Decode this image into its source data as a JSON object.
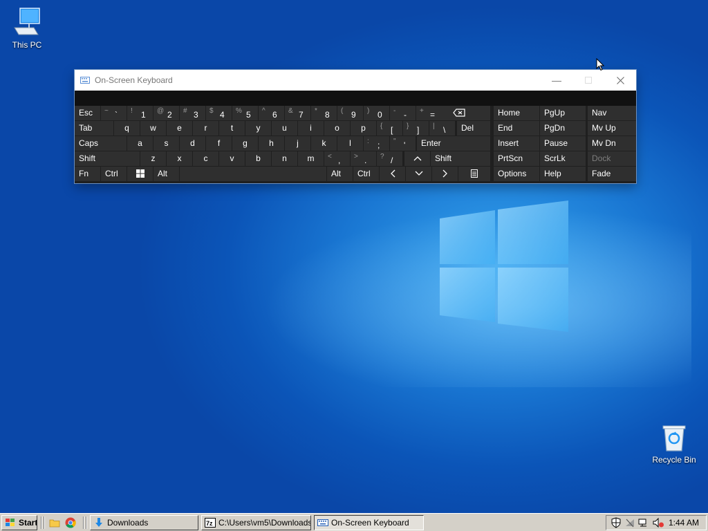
{
  "desktop": {
    "icons": [
      {
        "label": "This PC",
        "icon": "computer-icon"
      },
      {
        "label": "Recycle Bin",
        "icon": "recycle-bin-icon"
      }
    ]
  },
  "osk": {
    "title": "On-Screen Keyboard",
    "keys": {
      "esc": "Esc",
      "tab": "Tab",
      "caps": "Caps",
      "shift_l": "Shift",
      "fn": "Fn",
      "ctrl_l": "Ctrl",
      "alt_l": "Alt",
      "alt_r": "Alt",
      "ctrl_r": "Ctrl",
      "del": "Del",
      "enter": "Enter",
      "shift_r": "Shift",
      "home": "Home",
      "pgup": "PgUp",
      "nav": "Nav",
      "end": "End",
      "pgdn": "PgDn",
      "mvup": "Mv Up",
      "insert": "Insert",
      "pause": "Pause",
      "mvdn": "Mv Dn",
      "prtscn": "PrtScn",
      "scrlk": "ScrLk",
      "dock": "Dock",
      "options": "Options",
      "help": "Help",
      "fade": "Fade"
    },
    "number_row": [
      {
        "sub": "~",
        "main": "`"
      },
      {
        "sub": "!",
        "main": "1"
      },
      {
        "sub": "@",
        "main": "2"
      },
      {
        "sub": "#",
        "main": "3"
      },
      {
        "sub": "$",
        "main": "4"
      },
      {
        "sub": "%",
        "main": "5"
      },
      {
        "sub": "^",
        "main": "6"
      },
      {
        "sub": "&",
        "main": "7"
      },
      {
        "sub": "*",
        "main": "8"
      },
      {
        "sub": "(",
        "main": "9"
      },
      {
        "sub": ")",
        "main": "0"
      },
      {
        "sub": "-",
        "main": "-"
      },
      {
        "sub": "+",
        "main": "="
      }
    ],
    "qwerty_row": [
      "q",
      "w",
      "e",
      "r",
      "t",
      "y",
      "u",
      "i",
      "o",
      "p"
    ],
    "qwerty_punct": [
      {
        "sub": "{",
        "main": "["
      },
      {
        "sub": "}",
        "main": "]"
      },
      {
        "sub": "|",
        "main": "\\"
      }
    ],
    "home_row": [
      "a",
      "s",
      "d",
      "f",
      "g",
      "h",
      "j",
      "k",
      "l"
    ],
    "home_punct": [
      {
        "sub": ":",
        "main": ";"
      },
      {
        "sub": "\"",
        "main": "'"
      }
    ],
    "bottom_row": [
      "z",
      "x",
      "c",
      "v",
      "b",
      "n",
      "m"
    ],
    "bottom_punct": [
      {
        "sub": "<",
        "main": ","
      },
      {
        "sub": ">",
        "main": "."
      },
      {
        "sub": "?",
        "main": "/"
      }
    ]
  },
  "taskbar": {
    "start_label": "Start",
    "tasks": [
      {
        "label": "Downloads",
        "icon": "download-arrow-icon"
      },
      {
        "label": "C:\\Users\\vm5\\Downloads...",
        "icon": "7zip-icon"
      },
      {
        "label": "On-Screen Keyboard",
        "icon": "keyboard-icon",
        "active": true
      }
    ],
    "clock": "1:44 AM"
  }
}
